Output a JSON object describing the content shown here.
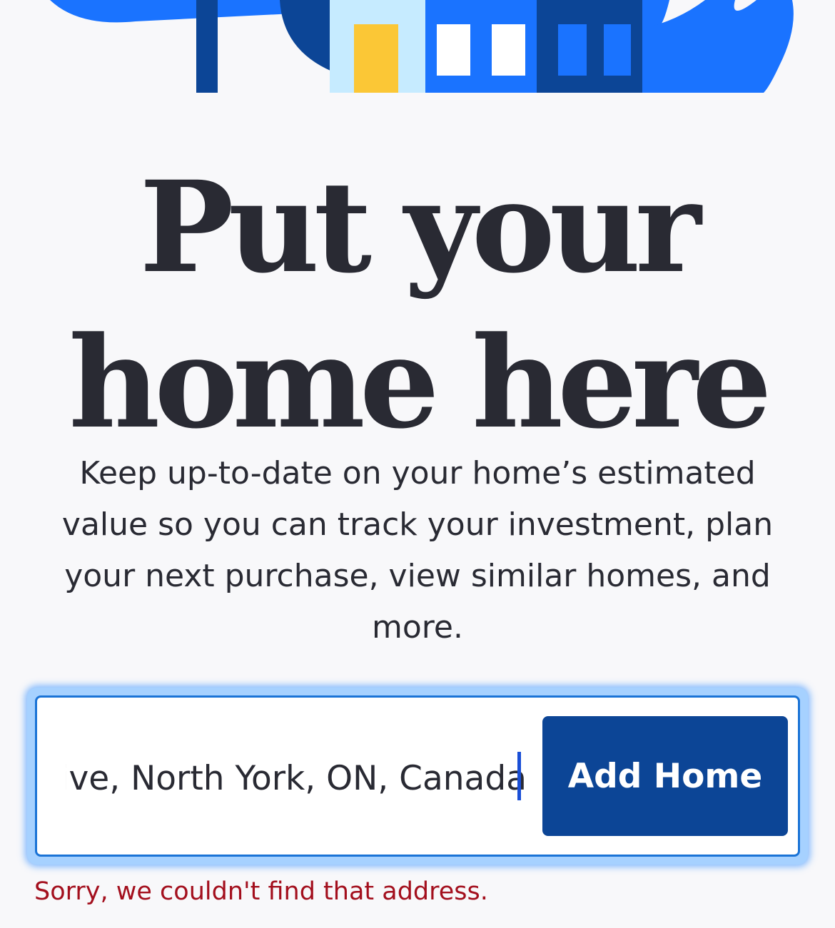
{
  "hero": {
    "headline_line1": "Put your",
    "headline_line2": "home here",
    "subtitle": "Keep up-to-date on your home’s estimated value so you can track your investment, plan your next purchase, view similar homes, and more."
  },
  "search": {
    "value_visible": "rive, North York, ON, Canada",
    "add_button_label": "Add Home",
    "error_message": "Sorry, we couldn't find that address."
  },
  "colors": {
    "background": "#f8f8fa",
    "text": "#292a33",
    "primary_button": "#0c4596",
    "field_border": "#1a73d6",
    "focus_glow": "#a6d1ff",
    "error": "#a30f1d",
    "illustration_blue": "#1a73ff",
    "illustration_dark_blue": "#0c4596",
    "illustration_light_blue": "#c6ebff",
    "illustration_yellow": "#fbc736"
  }
}
